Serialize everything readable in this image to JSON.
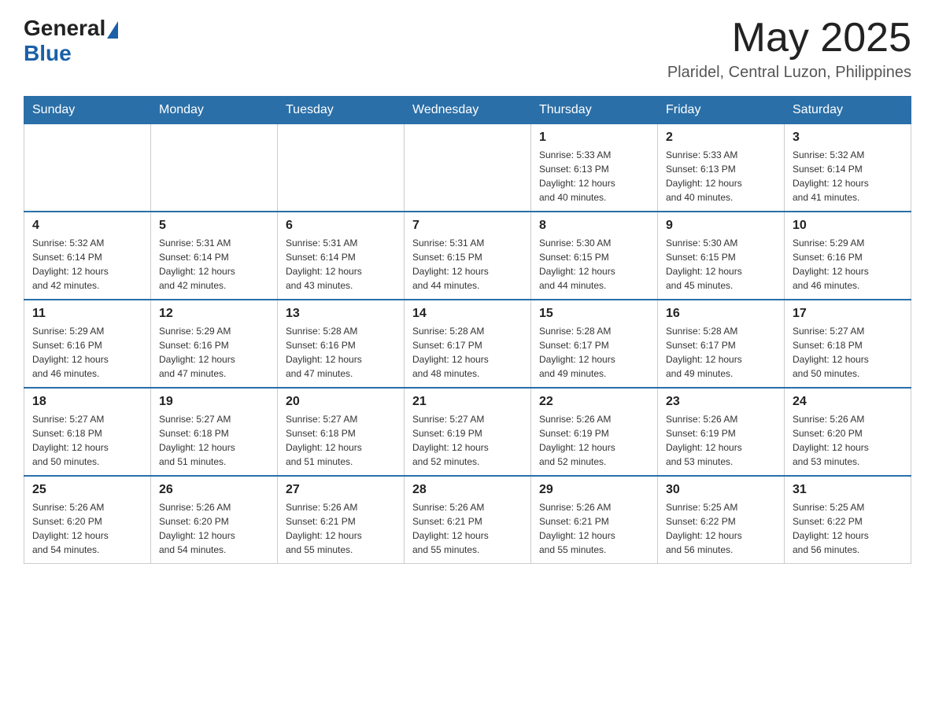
{
  "header": {
    "logo_general": "General",
    "logo_blue": "Blue",
    "month_title": "May 2025",
    "location": "Plaridel, Central Luzon, Philippines"
  },
  "days_of_week": [
    "Sunday",
    "Monday",
    "Tuesday",
    "Wednesday",
    "Thursday",
    "Friday",
    "Saturday"
  ],
  "weeks": [
    [
      {
        "day": "",
        "info": ""
      },
      {
        "day": "",
        "info": ""
      },
      {
        "day": "",
        "info": ""
      },
      {
        "day": "",
        "info": ""
      },
      {
        "day": "1",
        "info": "Sunrise: 5:33 AM\nSunset: 6:13 PM\nDaylight: 12 hours\nand 40 minutes."
      },
      {
        "day": "2",
        "info": "Sunrise: 5:33 AM\nSunset: 6:13 PM\nDaylight: 12 hours\nand 40 minutes."
      },
      {
        "day": "3",
        "info": "Sunrise: 5:32 AM\nSunset: 6:14 PM\nDaylight: 12 hours\nand 41 minutes."
      }
    ],
    [
      {
        "day": "4",
        "info": "Sunrise: 5:32 AM\nSunset: 6:14 PM\nDaylight: 12 hours\nand 42 minutes."
      },
      {
        "day": "5",
        "info": "Sunrise: 5:31 AM\nSunset: 6:14 PM\nDaylight: 12 hours\nand 42 minutes."
      },
      {
        "day": "6",
        "info": "Sunrise: 5:31 AM\nSunset: 6:14 PM\nDaylight: 12 hours\nand 43 minutes."
      },
      {
        "day": "7",
        "info": "Sunrise: 5:31 AM\nSunset: 6:15 PM\nDaylight: 12 hours\nand 44 minutes."
      },
      {
        "day": "8",
        "info": "Sunrise: 5:30 AM\nSunset: 6:15 PM\nDaylight: 12 hours\nand 44 minutes."
      },
      {
        "day": "9",
        "info": "Sunrise: 5:30 AM\nSunset: 6:15 PM\nDaylight: 12 hours\nand 45 minutes."
      },
      {
        "day": "10",
        "info": "Sunrise: 5:29 AM\nSunset: 6:16 PM\nDaylight: 12 hours\nand 46 minutes."
      }
    ],
    [
      {
        "day": "11",
        "info": "Sunrise: 5:29 AM\nSunset: 6:16 PM\nDaylight: 12 hours\nand 46 minutes."
      },
      {
        "day": "12",
        "info": "Sunrise: 5:29 AM\nSunset: 6:16 PM\nDaylight: 12 hours\nand 47 minutes."
      },
      {
        "day": "13",
        "info": "Sunrise: 5:28 AM\nSunset: 6:16 PM\nDaylight: 12 hours\nand 47 minutes."
      },
      {
        "day": "14",
        "info": "Sunrise: 5:28 AM\nSunset: 6:17 PM\nDaylight: 12 hours\nand 48 minutes."
      },
      {
        "day": "15",
        "info": "Sunrise: 5:28 AM\nSunset: 6:17 PM\nDaylight: 12 hours\nand 49 minutes."
      },
      {
        "day": "16",
        "info": "Sunrise: 5:28 AM\nSunset: 6:17 PM\nDaylight: 12 hours\nand 49 minutes."
      },
      {
        "day": "17",
        "info": "Sunrise: 5:27 AM\nSunset: 6:18 PM\nDaylight: 12 hours\nand 50 minutes."
      }
    ],
    [
      {
        "day": "18",
        "info": "Sunrise: 5:27 AM\nSunset: 6:18 PM\nDaylight: 12 hours\nand 50 minutes."
      },
      {
        "day": "19",
        "info": "Sunrise: 5:27 AM\nSunset: 6:18 PM\nDaylight: 12 hours\nand 51 minutes."
      },
      {
        "day": "20",
        "info": "Sunrise: 5:27 AM\nSunset: 6:18 PM\nDaylight: 12 hours\nand 51 minutes."
      },
      {
        "day": "21",
        "info": "Sunrise: 5:27 AM\nSunset: 6:19 PM\nDaylight: 12 hours\nand 52 minutes."
      },
      {
        "day": "22",
        "info": "Sunrise: 5:26 AM\nSunset: 6:19 PM\nDaylight: 12 hours\nand 52 minutes."
      },
      {
        "day": "23",
        "info": "Sunrise: 5:26 AM\nSunset: 6:19 PM\nDaylight: 12 hours\nand 53 minutes."
      },
      {
        "day": "24",
        "info": "Sunrise: 5:26 AM\nSunset: 6:20 PM\nDaylight: 12 hours\nand 53 minutes."
      }
    ],
    [
      {
        "day": "25",
        "info": "Sunrise: 5:26 AM\nSunset: 6:20 PM\nDaylight: 12 hours\nand 54 minutes."
      },
      {
        "day": "26",
        "info": "Sunrise: 5:26 AM\nSunset: 6:20 PM\nDaylight: 12 hours\nand 54 minutes."
      },
      {
        "day": "27",
        "info": "Sunrise: 5:26 AM\nSunset: 6:21 PM\nDaylight: 12 hours\nand 55 minutes."
      },
      {
        "day": "28",
        "info": "Sunrise: 5:26 AM\nSunset: 6:21 PM\nDaylight: 12 hours\nand 55 minutes."
      },
      {
        "day": "29",
        "info": "Sunrise: 5:26 AM\nSunset: 6:21 PM\nDaylight: 12 hours\nand 55 minutes."
      },
      {
        "day": "30",
        "info": "Sunrise: 5:25 AM\nSunset: 6:22 PM\nDaylight: 12 hours\nand 56 minutes."
      },
      {
        "day": "31",
        "info": "Sunrise: 5:25 AM\nSunset: 6:22 PM\nDaylight: 12 hours\nand 56 minutes."
      }
    ]
  ]
}
